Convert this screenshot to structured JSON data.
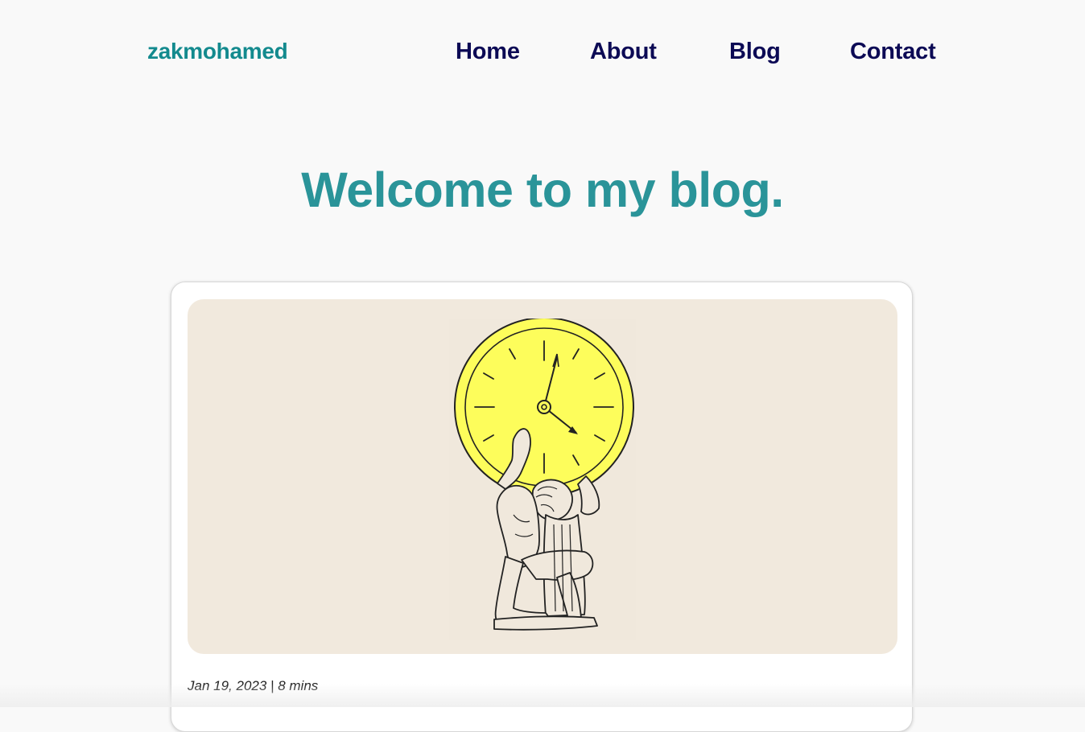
{
  "header": {
    "brand": "zakmohamed",
    "nav": [
      "Home",
      "About",
      "Blog",
      "Contact"
    ]
  },
  "hero": {
    "title": "Welcome to my blog."
  },
  "post": {
    "image_description_icon": "atlas-clock-illustration",
    "date": "Jan 19, 2023",
    "separator": "|",
    "read_time": "8 mins"
  },
  "colors": {
    "brand": "#138a8e",
    "nav": "#0c0a55",
    "hero": "#2a9499",
    "clock_face": "#fdfd5b",
    "image_bg": "#f1e9dd"
  }
}
